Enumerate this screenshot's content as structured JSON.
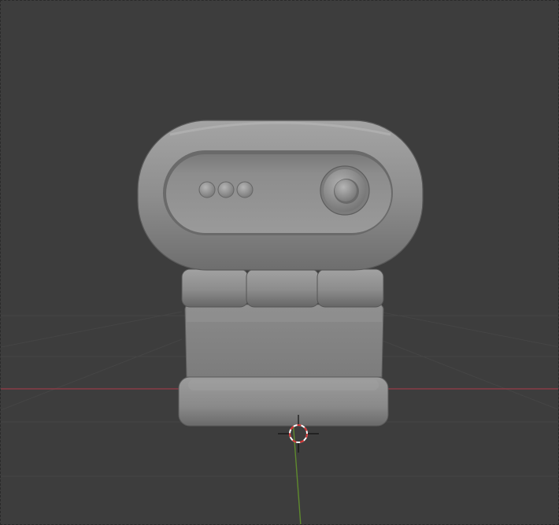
{
  "viewport": {
    "background": "#3d3d3d",
    "grid_color": "#454545",
    "x_axis_color": "#8a3d46",
    "y_axis_color": "#5f8a2e"
  },
  "scene": {
    "object": "webcam-model",
    "material_color": "#8c8c8c"
  },
  "icons": {
    "cursor": "3d-cursor-icon"
  }
}
